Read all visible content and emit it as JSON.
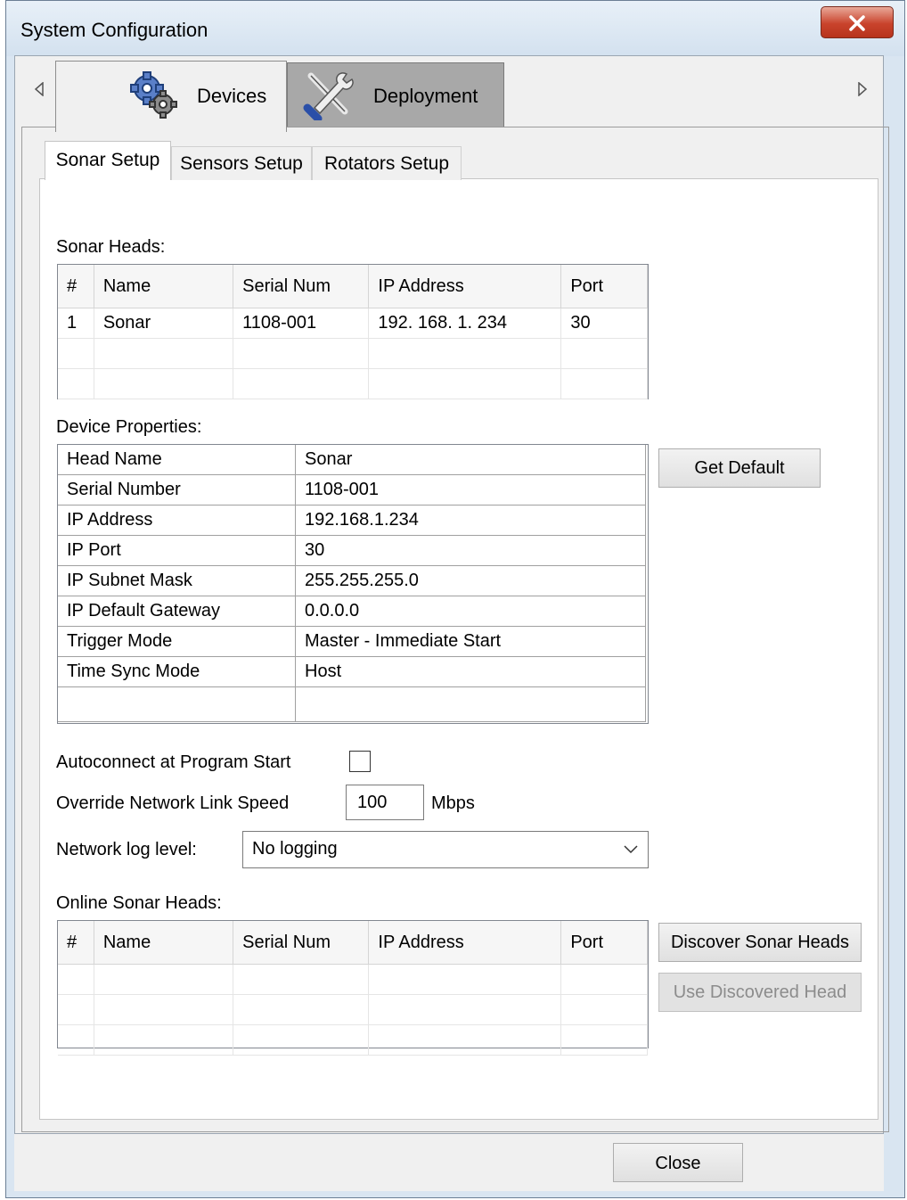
{
  "window": {
    "title": "System Configuration"
  },
  "main_tabs": [
    {
      "label": "Devices",
      "icon": "gears-icon",
      "active": true
    },
    {
      "label": "Deployment",
      "icon": "tools-icon",
      "active": false
    }
  ],
  "sub_tabs": [
    {
      "label": "Sonar Setup",
      "active": true
    },
    {
      "label": "Sensors Setup",
      "active": false
    },
    {
      "label": "Rotators Setup",
      "active": false
    }
  ],
  "sonar_heads": {
    "label": "Sonar Heads:",
    "columns": [
      "#",
      "Name",
      "Serial Num",
      "IP Address",
      "Port"
    ],
    "rows": [
      [
        "1",
        "Sonar",
        "1108-001",
        "192. 168. 1. 234",
        "30"
      ]
    ]
  },
  "device_properties": {
    "label": "Device Properties:",
    "rows": [
      [
        "Head Name",
        "Sonar"
      ],
      [
        "Serial Number",
        "1108-001"
      ],
      [
        "IP Address",
        "192.168.1.234"
      ],
      [
        "IP Port",
        "30"
      ],
      [
        "IP Subnet Mask",
        "255.255.255.0"
      ],
      [
        "IP Default Gateway",
        "0.0.0.0"
      ],
      [
        "Trigger Mode",
        "Master - Immediate Start"
      ],
      [
        "Time Sync Mode",
        "Host"
      ]
    ],
    "get_default_label": "Get Default"
  },
  "options": {
    "autoconnect_label": "Autoconnect at Program Start",
    "autoconnect_checked": false,
    "link_speed_label": "Override Network Link Speed",
    "link_speed_value": "100",
    "link_speed_unit": "Mbps",
    "log_level_label": "Network log level:",
    "log_level_value": "No logging"
  },
  "online_heads": {
    "label": "Online Sonar Heads:",
    "columns": [
      "#",
      "Name",
      "Serial Num",
      "IP Address",
      "Port"
    ],
    "rows": [],
    "discover_label": "Discover Sonar Heads",
    "use_discovered_label": "Use Discovered Head"
  },
  "footer": {
    "close_label": "Close"
  },
  "colors": {
    "title_close": "#c9432c",
    "inactive_tab": "#a8a8a8"
  }
}
